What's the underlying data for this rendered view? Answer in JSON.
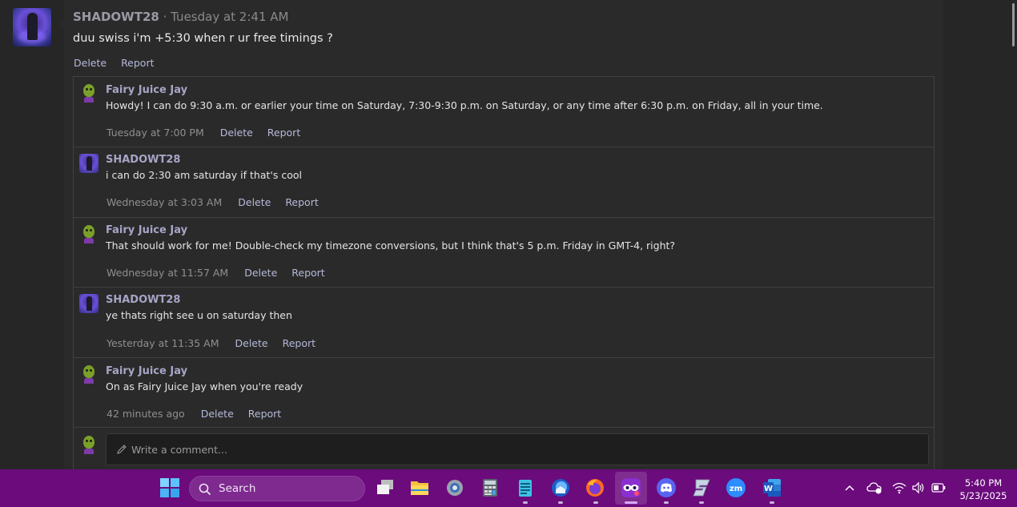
{
  "post": {
    "author": "SHADOWT28",
    "separator": "·",
    "time": "Tuesday at 2:41 AM",
    "body": "duu swiss i'm +5:30 when r ur free timings ?",
    "actions": {
      "delete": "Delete",
      "report": "Report"
    }
  },
  "comments": [
    {
      "author": "Fairy Juice Jay",
      "avatar": "jay-avatar",
      "text": "Howdy! I can do 9:30 a.m. or earlier your time on Saturday, 7:30-9:30 p.m. on Saturday, or any time after 6:30 p.m. on Friday, all in your time.",
      "time": "Tuesday at 7:00 PM",
      "delete": "Delete",
      "report": "Report"
    },
    {
      "author": "SHADOWT28",
      "avatar": "shadow-avatar",
      "text": "i can do 2:30 am saturday if that's cool",
      "time": "Wednesday at 3:03 AM",
      "delete": "Delete",
      "report": "Report"
    },
    {
      "author": "Fairy Juice Jay",
      "avatar": "jay-avatar",
      "text": "That should work for me! Double-check my timezone conversions, but I think that's 5 p.m. Friday in GMT-4, right?",
      "time": "Wednesday at 11:57 AM",
      "delete": "Delete",
      "report": "Report"
    },
    {
      "author": "SHADOWT28",
      "avatar": "shadow-avatar",
      "text": "ye thats right see u on saturday then",
      "time": "Yesterday at 11:35 AM",
      "delete": "Delete",
      "report": "Report"
    },
    {
      "author": "Fairy Juice Jay",
      "avatar": "jay-avatar",
      "text": "On as Fairy Juice Jay when you're ready",
      "time": "42 minutes ago",
      "delete": "Delete",
      "report": "Report"
    }
  ],
  "comment_input": {
    "placeholder": "Write a comment..."
  },
  "taskbar": {
    "search_label": "Search",
    "apps": [
      "windows-start-icon",
      "task-view-icon",
      "file-explorer-icon",
      "settings-icon",
      "calculator-icon",
      "notepad-icon",
      "thunderbird-icon",
      "firefox-icon",
      "mask-app-icon",
      "discord-icon",
      "steelseries-icon",
      "zoom-icon",
      "word-icon"
    ],
    "clock_time": "5:40 PM",
    "clock_date": "5/23/2025"
  },
  "colors": {
    "taskbar": "#6b0b7c",
    "link": "#b5b9d9",
    "author": "#a7a5c6",
    "background": "#2a2a2a"
  }
}
